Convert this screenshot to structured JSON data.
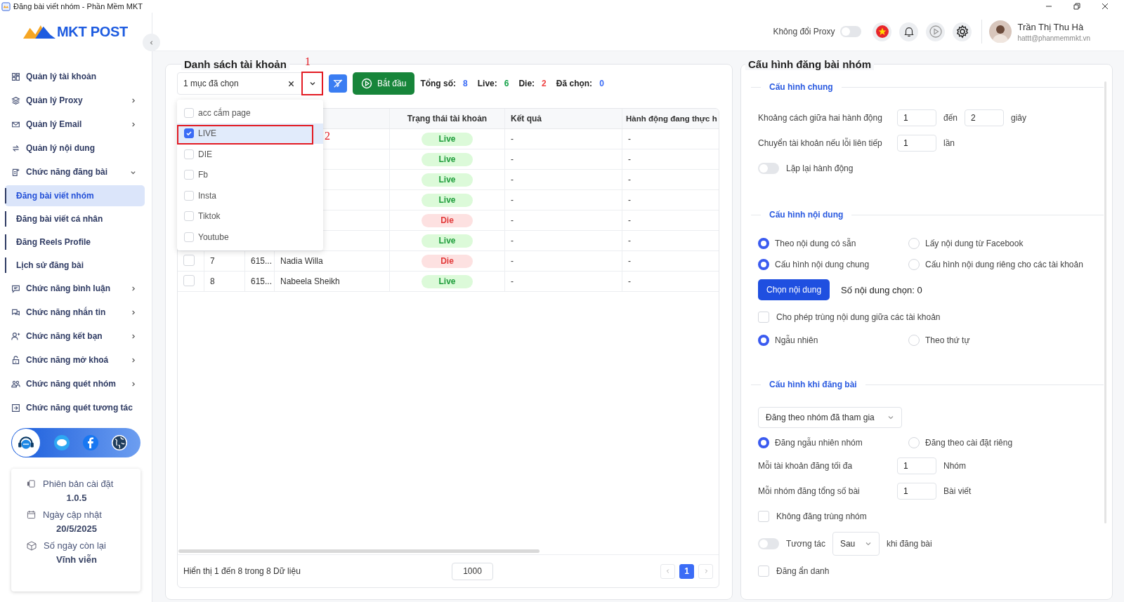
{
  "window": {
    "title": "Đăng bài viết nhóm - Phần Mềm MKT"
  },
  "sidebar": {
    "logo": "MKT POST",
    "items": [
      {
        "label": "Quản lý tài khoản"
      },
      {
        "label": "Quản lý Proxy",
        "expanded": false
      },
      {
        "label": "Quản lý Email",
        "expanded": false
      },
      {
        "label": "Quản lý nội dung"
      },
      {
        "label": "Chức năng đăng bài",
        "expanded": true,
        "children": [
          {
            "label": "Đăng bài viết nhóm",
            "selected": true
          },
          {
            "label": "Đăng bài viết cá nhân",
            "selected": false
          },
          {
            "label": "Đăng Reels Profile",
            "selected": false
          },
          {
            "label": "Lịch sử đăng bài",
            "selected": false
          }
        ]
      },
      {
        "label": "Chức năng bình luận",
        "expanded": false
      },
      {
        "label": "Chức năng nhắn tin",
        "expanded": false
      },
      {
        "label": "Chức năng kết bạn",
        "expanded": false
      },
      {
        "label": "Chức năng mở khoá",
        "expanded": false
      },
      {
        "label": "Chức năng quét nhóm",
        "expanded": false
      },
      {
        "label": "Chức năng quét tương tác"
      }
    ],
    "info": [
      {
        "label": "Phiên bản cài đặt",
        "value": "1.0.5"
      },
      {
        "label": "Ngày cập nhật",
        "value": "20/5/2025"
      },
      {
        "label": "Số ngày còn lại",
        "value": "Vĩnh viễn"
      }
    ]
  },
  "header": {
    "proxy_toggle": {
      "label": "Không đổi Proxy",
      "on": false
    },
    "user": {
      "name": "Trần Thị Thu Hà",
      "email": "hattt@phanmemmkt.vn"
    }
  },
  "accounts": {
    "title": "Danh sách tài khoản",
    "filter": {
      "value": "1 mục đã chọn",
      "options": [
        {
          "label": "acc cắm page",
          "checked": false
        },
        {
          "label": "LIVE",
          "checked": true
        },
        {
          "label": "DIE",
          "checked": false
        },
        {
          "label": "Fb",
          "checked": false
        },
        {
          "label": "Insta",
          "checked": false
        },
        {
          "label": "Tiktok",
          "checked": false
        },
        {
          "label": "Youtube",
          "checked": false
        }
      ]
    },
    "start_button": "Bắt đầu",
    "stats": [
      {
        "label": "Tổng số:",
        "value": "8",
        "color": "#3b6cf6"
      },
      {
        "label": "Live:",
        "value": "6",
        "color": "#16a34a"
      },
      {
        "label": "Die:",
        "value": "2",
        "color": "#ef4444"
      },
      {
        "label": "Đã chọn:",
        "value": "0",
        "color": "#3b6cf6"
      }
    ],
    "table": {
      "columns": [
        {
          "label": "Trạng thái tài khoản"
        },
        {
          "label": "Kết quả"
        },
        {
          "label": "Hành động đang thực h"
        }
      ],
      "rows": [
        {
          "status": "Live",
          "kind": "live",
          "result": "-",
          "action": "-"
        },
        {
          "status": "Live",
          "kind": "live",
          "result": "-",
          "action": "-"
        },
        {
          "status": "Live",
          "kind": "live",
          "result": "-",
          "action": "-"
        },
        {
          "status": "Live",
          "kind": "live",
          "result": "-",
          "action": "-"
        },
        {
          "status": "Die",
          "kind": "die",
          "result": "-",
          "action": "-"
        },
        {
          "status": "Live",
          "kind": "live",
          "result": "-",
          "action": "-"
        },
        {
          "checked": false,
          "index": "7",
          "uid": "615...",
          "name": "Nadia Willa",
          "status": "Die",
          "kind": "die",
          "result": "-",
          "action": "-"
        },
        {
          "checked": false,
          "index": "8",
          "uid": "615...",
          "name": "Nabeela Sheikh",
          "status": "Live",
          "kind": "live",
          "result": "-",
          "action": "-"
        }
      ]
    },
    "footer": {
      "summary": "Hiển thị 1 đến 8 trong 8 Dữ liệu",
      "page_size": "1000",
      "pages": [
        {
          "label": "1",
          "selected": true
        }
      ]
    },
    "annotations": [
      {
        "label": "1"
      },
      {
        "label": "2"
      }
    ]
  },
  "config": {
    "title": "Cấu hình đăng bài nhóm",
    "sections": [
      {
        "title": "Cấu hình chung",
        "rows": [
          {
            "kind": "range",
            "label": "Khoảng cách giữa hai hành động",
            "from": "1",
            "joiner": "đến",
            "to": "2",
            "unit": "giây"
          },
          {
            "kind": "number",
            "label": "Chuyển tài khoản nếu lỗi liên tiếp",
            "value": "1",
            "unit": "lần"
          },
          {
            "kind": "toggle",
            "label": "Lặp lại hành động",
            "on": false
          }
        ]
      },
      {
        "title": "Cấu hình nội dung",
        "rows": [
          {
            "kind": "radios",
            "options": [
              {
                "label": "Theo nội dung có sẵn",
                "selected": true
              },
              {
                "label": "Lấy nội dung từ Facebook",
                "selected": false
              }
            ]
          },
          {
            "kind": "radios",
            "options": [
              {
                "label": "Cấu hình nội dung chung",
                "selected": true
              },
              {
                "label": "Cấu hình nội dung riêng cho các tài khoản",
                "selected": false
              }
            ]
          },
          {
            "kind": "button",
            "button": "Chọn nội dung",
            "text": "Số nội dung chọn: 0"
          },
          {
            "kind": "checkbox",
            "label": "Cho phép trùng nội dung giữa các tài khoản",
            "checked": false
          },
          {
            "kind": "radios",
            "options": [
              {
                "label": "Ngẫu nhiên",
                "selected": true
              },
              {
                "label": "Theo thứ tự",
                "selected": false
              }
            ]
          }
        ]
      },
      {
        "title": "Cấu hình khi đăng bài",
        "rows": [
          {
            "kind": "select",
            "value": "Đăng theo nhóm đã tham gia"
          },
          {
            "kind": "radios",
            "options": [
              {
                "label": "Đăng ngẫu nhiên nhóm",
                "selected": true
              },
              {
                "label": "Đăng theo cài đặt riêng",
                "selected": false
              }
            ]
          },
          {
            "kind": "number",
            "label": "Mỗi tài khoản đăng tối đa",
            "value": "1",
            "unit": "Nhóm"
          },
          {
            "kind": "number",
            "label": "Mỗi nhóm đăng tổng số bài",
            "value": "1",
            "unit": "Bài viết"
          },
          {
            "kind": "checkbox",
            "label": "Không đăng trùng nhóm",
            "checked": false
          },
          {
            "kind": "toggle_select",
            "on": false,
            "label": "Tương tác",
            "value": "Sau",
            "unit": "khi đăng bài"
          },
          {
            "kind": "checkbox",
            "label": "Đăng ẩn danh",
            "checked": false
          }
        ]
      }
    ]
  }
}
